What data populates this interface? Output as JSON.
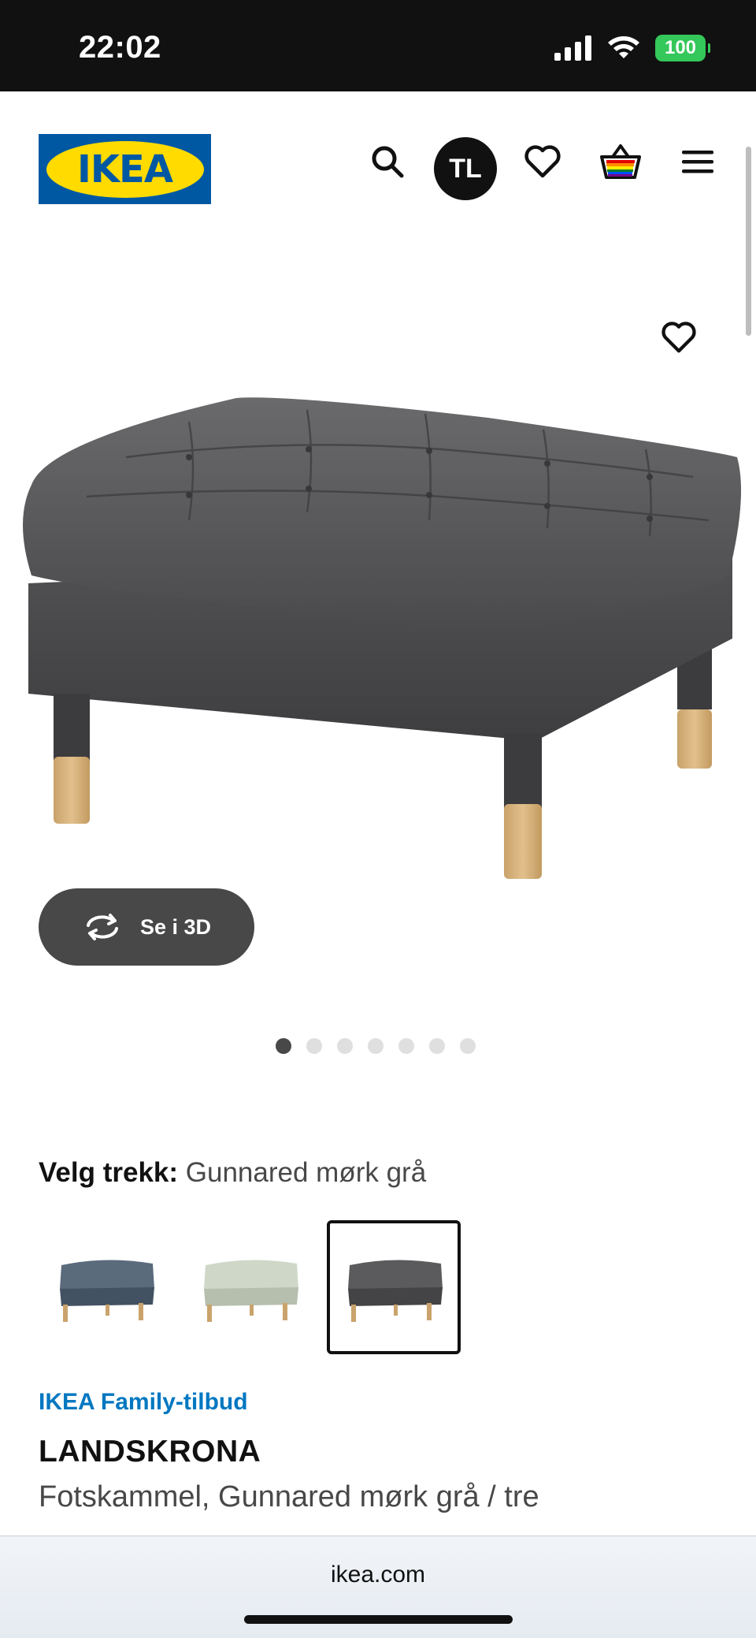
{
  "status_bar": {
    "time": "22:02",
    "battery": "100",
    "icons": [
      "signal-icon",
      "wifi-icon",
      "battery-icon"
    ]
  },
  "header": {
    "logo_text": "IKEA",
    "avatar_initials": "TL",
    "icons": [
      "search-icon",
      "heart-icon",
      "basket-icon",
      "menu-icon"
    ]
  },
  "product_image": {
    "view_3d_label": "Se i 3D",
    "image_count": 7,
    "active_image": 1
  },
  "variants": {
    "choose_label": "Velg trekk:",
    "selected_value": "Gunnared mørk grå",
    "swatches": [
      {
        "color": "#4e5d6c",
        "selected": false
      },
      {
        "color": "#c3ccbc",
        "selected": false
      },
      {
        "color": "#4f4f52",
        "selected": true
      }
    ]
  },
  "product": {
    "family_offer": "IKEA Family-tilbud",
    "name": "LANDSKRONA",
    "description": "Fotskammel, Gunnared mørk grå / tre"
  },
  "browser": {
    "url": "ikea.com"
  },
  "colors": {
    "ikea_blue": "#0058a3",
    "ikea_yellow": "#ffdb00",
    "family_blue": "#0077c1",
    "button_dark": "#484848"
  }
}
